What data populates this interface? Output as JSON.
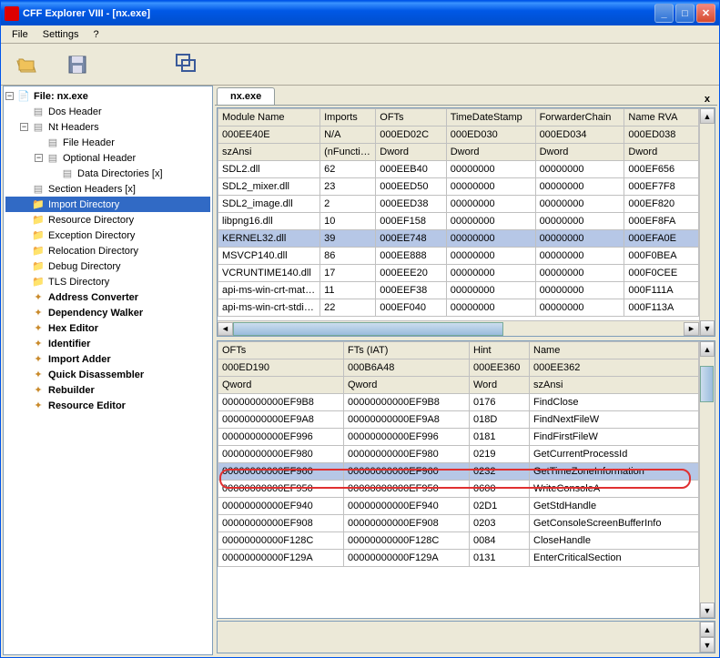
{
  "title": "CFF Explorer VIII - [nx.exe]",
  "menu": {
    "file": "File",
    "settings": "Settings",
    "help": "?"
  },
  "tab": {
    "label": "nx.exe",
    "close": "x"
  },
  "tree": {
    "root": "File: nx.exe",
    "dos": "Dos Header",
    "nt": "Nt Headers",
    "fileh": "File Header",
    "opth": "Optional Header",
    "datad": "Data Directories [x]",
    "sect": "Section Headers [x]",
    "impd": "Import Directory",
    "resd": "Resource Directory",
    "excd": "Exception Directory",
    "reld": "Relocation Directory",
    "dbgd": "Debug Directory",
    "tlsd": "TLS Directory",
    "addrc": "Address Converter",
    "depw": "Dependency Walker",
    "hexe": "Hex Editor",
    "ident": "Identifier",
    "impa": "Import Adder",
    "qdis": "Quick Disassembler",
    "rebld": "Rebuilder",
    "resed": "Resource Editor"
  },
  "topGrid": {
    "headers": [
      "Module Name",
      "Imports",
      "OFTs",
      "TimeDateStamp",
      "ForwarderChain",
      "Name RVA"
    ],
    "meta1": [
      "000EE40E",
      "N/A",
      "000ED02C",
      "000ED030",
      "000ED034",
      "000ED038"
    ],
    "meta2": [
      "szAnsi",
      "(nFunctions)",
      "Dword",
      "Dword",
      "Dword",
      "Dword"
    ],
    "rows": [
      [
        "SDL2.dll",
        "62",
        "000EEB40",
        "00000000",
        "00000000",
        "000EF656"
      ],
      [
        "SDL2_mixer.dll",
        "23",
        "000EED50",
        "00000000",
        "00000000",
        "000EF7F8"
      ],
      [
        "SDL2_image.dll",
        "2",
        "000EED38",
        "00000000",
        "00000000",
        "000EF820"
      ],
      [
        "libpng16.dll",
        "10",
        "000EF158",
        "00000000",
        "00000000",
        "000EF8FA"
      ],
      [
        "KERNEL32.dll",
        "39",
        "000EE748",
        "00000000",
        "00000000",
        "000EFA0E"
      ],
      [
        "MSVCP140.dll",
        "86",
        "000EE888",
        "00000000",
        "00000000",
        "000F0BEA"
      ],
      [
        "VCRUNTIME140.dll",
        "17",
        "000EEE20",
        "00000000",
        "00000000",
        "000F0CEE"
      ],
      [
        "api-ms-win-crt-math-l...",
        "11",
        "000EEF38",
        "00000000",
        "00000000",
        "000F111A"
      ],
      [
        "api-ms-win-crt-stdio-l...",
        "22",
        "000EF040",
        "00000000",
        "00000000",
        "000F113A"
      ]
    ],
    "selectedIndex": 4
  },
  "botGrid": {
    "headers": [
      "OFTs",
      "FTs (IAT)",
      "Hint",
      "Name"
    ],
    "meta1": [
      "000ED190",
      "000B6A48",
      "000EE360",
      "000EE362"
    ],
    "meta2": [
      "Qword",
      "Qword",
      "Word",
      "szAnsi"
    ],
    "rows": [
      [
        "00000000000EF9B8",
        "00000000000EF9B8",
        "0176",
        "FindClose"
      ],
      [
        "00000000000EF9A8",
        "00000000000EF9A8",
        "018D",
        "FindNextFileW"
      ],
      [
        "00000000000EF996",
        "00000000000EF996",
        "0181",
        "FindFirstFileW"
      ],
      [
        "00000000000EF980",
        "00000000000EF980",
        "0219",
        "GetCurrentProcessId"
      ],
      [
        "00000000000EF960",
        "00000000000EF960",
        "0232",
        "GetTimeZoneInformation"
      ],
      [
        "00000000000EF950",
        "00000000000EF950",
        "0600",
        "WriteConsoleA"
      ],
      [
        "00000000000EF940",
        "00000000000EF940",
        "02D1",
        "GetStdHandle"
      ],
      [
        "00000000000EF908",
        "00000000000EF908",
        "0203",
        "GetConsoleScreenBufferInfo"
      ],
      [
        "00000000000F128C",
        "00000000000F128C",
        "0084",
        "CloseHandle"
      ],
      [
        "00000000000F129A",
        "00000000000F129A",
        "0131",
        "EnterCriticalSection"
      ]
    ],
    "selectedIndex": 4
  }
}
